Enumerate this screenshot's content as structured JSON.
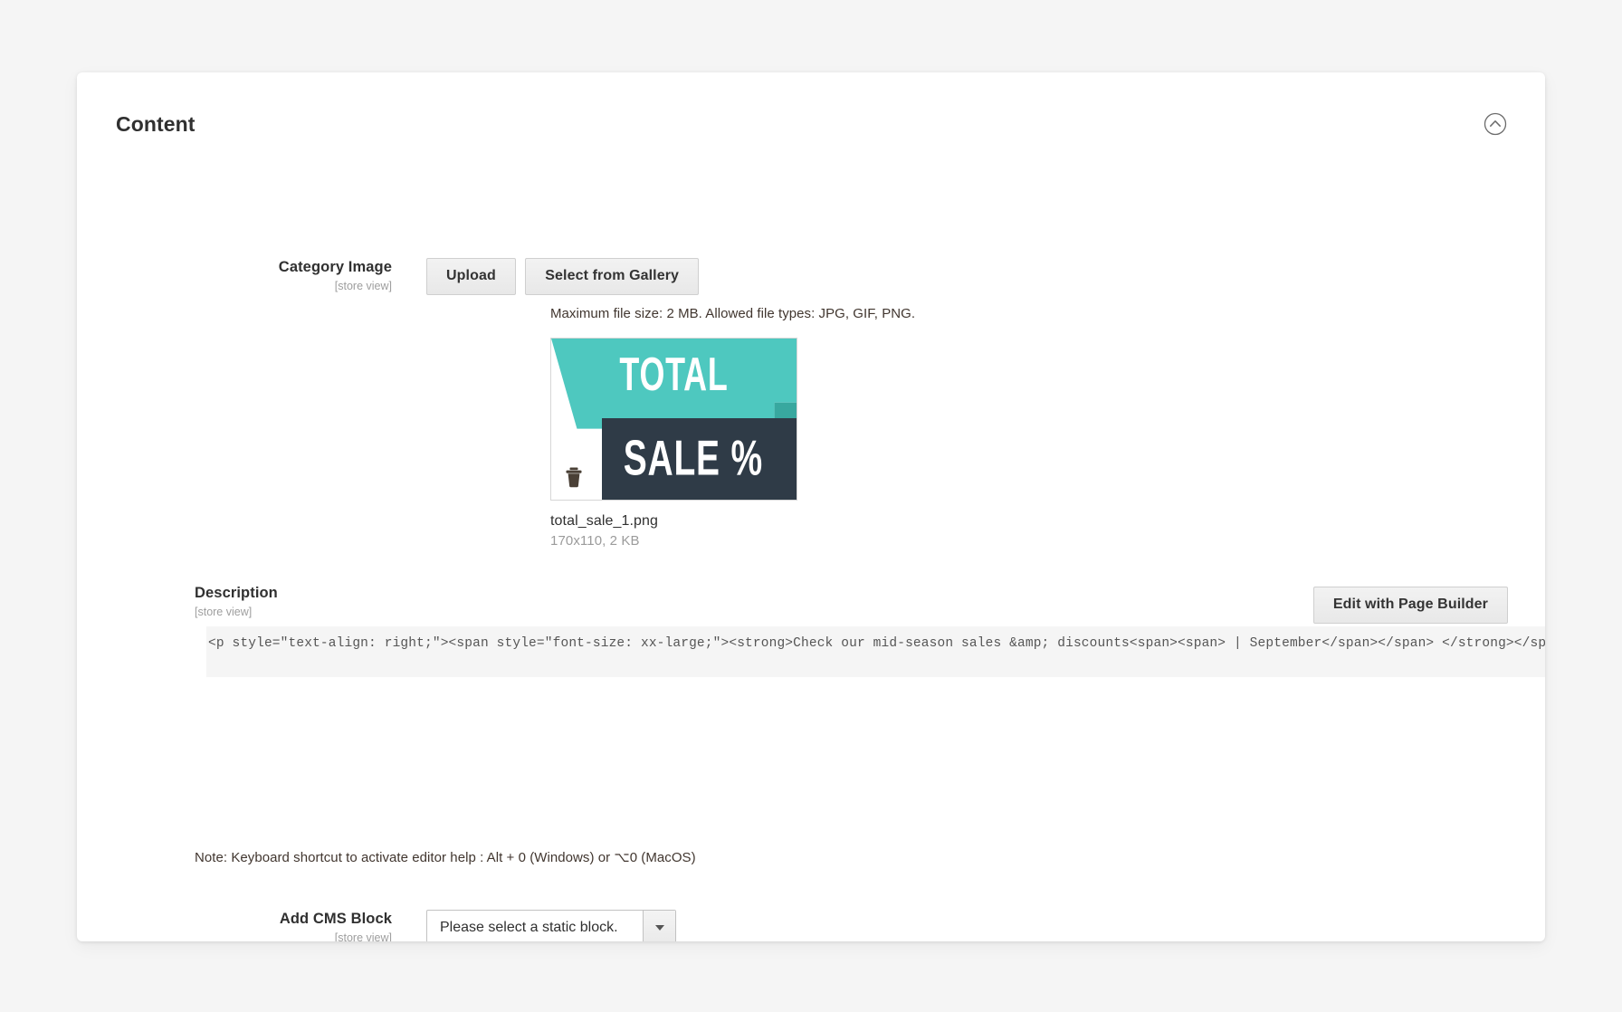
{
  "panel": {
    "title": "Content",
    "collapse_icon": "chevron-up-circle-icon"
  },
  "category_image": {
    "label": "Category Image",
    "scope": "[store view]",
    "upload_label": "Upload",
    "gallery_label": "Select from Gallery",
    "upload_note": "Maximum file size: 2 MB. Allowed file types: JPG, GIF, PNG.",
    "preview": {
      "word_top": "TOTAL",
      "word_bottom": "SALE %",
      "teal_color": "#4ec8bf",
      "dark_color": "#2f3b47",
      "delete_icon": "trash-icon"
    },
    "file_name": "total_sale_1.png",
    "file_meta": "170x110, 2 KB"
  },
  "description": {
    "label": "Description",
    "scope": "[store view]",
    "page_builder_label": "Edit with Page Builder",
    "code": "<p style=\"text-align: right;\"><span style=\"font-size: xx-large;\"><strong>Check our mid-season sales &amp; discounts<span><span> | September</span></span> </strong></span></p>",
    "editor_note": "Note: Keyboard shortcut to activate editor help : Alt + 0 (Windows) or ⌥0 (MacOS)"
  },
  "cms_block": {
    "label": "Add CMS Block",
    "scope": "[store view]",
    "selected": "Please select a static block.",
    "caret_icon": "chevron-down-icon"
  }
}
